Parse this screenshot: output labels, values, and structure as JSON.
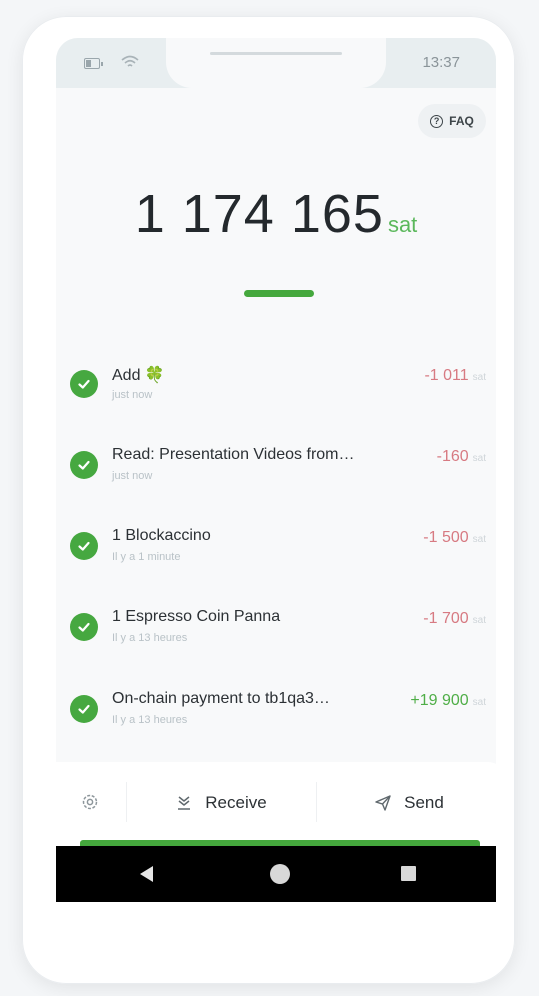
{
  "status_bar": {
    "time": "13:37"
  },
  "faq": {
    "label": "FAQ"
  },
  "balance": {
    "amount": "1 174 165",
    "unit": "sat"
  },
  "transactions": [
    {
      "title": "Add 🍀",
      "time": "just now",
      "amount": "-1 011",
      "unit": "sat",
      "direction": "out"
    },
    {
      "title": "Read: Presentation Videos from…",
      "time": "just now",
      "amount": "-160",
      "unit": "sat",
      "direction": "out"
    },
    {
      "title": "1 Blockaccino",
      "time": "Il y a 1 minute",
      "amount": "-1 500",
      "unit": "sat",
      "direction": "out"
    },
    {
      "title": "1 Espresso Coin Panna",
      "time": "Il y a 13 heures",
      "amount": "-1 700",
      "unit": "sat",
      "direction": "out"
    },
    {
      "title": "On-chain payment to tb1qa3…",
      "time": "Il y a 13 heures",
      "amount": "+19 900",
      "unit": "sat",
      "direction": "in"
    }
  ],
  "actions": {
    "receive_label": "Receive",
    "send_label": "Send"
  },
  "colors": {
    "accent": "#45a83d",
    "negative": "#d77a82",
    "positive": "#4fae47"
  },
  "icons": [
    "battery-icon",
    "wifi-icon",
    "faq-icon",
    "check-icon",
    "settings-icon",
    "receive-icon",
    "send-icon",
    "nav-back-icon",
    "nav-home-icon",
    "nav-recents-icon"
  ]
}
